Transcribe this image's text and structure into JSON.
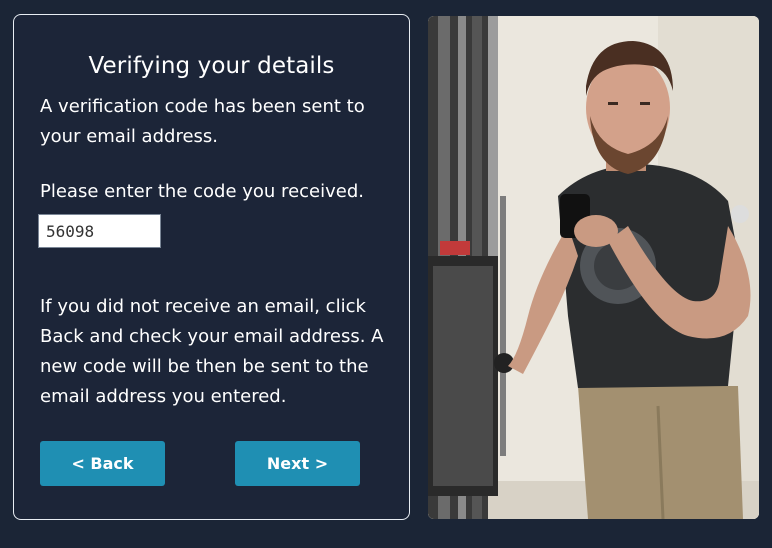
{
  "panel": {
    "title": "Verifying your details",
    "intro": "A verification code has been sent to your email address.",
    "prompt": "Please enter the code you received.",
    "code_value": "56098",
    "help": "If you did not receive an email, click Back and check your email address. A new code will be then be sent to the email address you entered."
  },
  "buttons": {
    "back_label": "< Back",
    "next_label": "Next >"
  },
  "colors": {
    "background": "#1b2536",
    "button": "#1f8fb3"
  }
}
